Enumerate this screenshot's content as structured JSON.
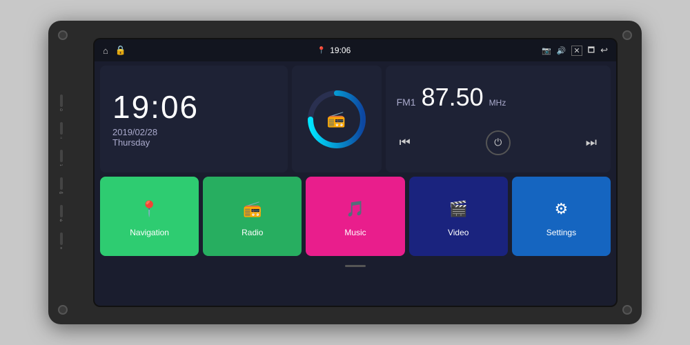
{
  "device": {
    "background_color": "#2a2a2a"
  },
  "status_bar": {
    "left_icons": [
      "home-icon",
      "lock-icon"
    ],
    "location_icon": "📍",
    "time": "19:06",
    "camera_icon": "📷",
    "volume_icon": "🔊",
    "screen_icon": "⬜",
    "window_icon": "🗔",
    "back_icon": "↩"
  },
  "clock": {
    "time": "19:06",
    "date": "2019/02/28",
    "day": "Thursday"
  },
  "radio": {
    "band": "FM1",
    "frequency": "87.50",
    "unit": "MHz",
    "arc_color_start": "#00bcd4",
    "arc_color_end": "#1a237e"
  },
  "apps": [
    {
      "id": "navigation",
      "label": "Navigation",
      "icon": "📍",
      "color": "#2ecc71"
    },
    {
      "id": "radio",
      "label": "Radio",
      "icon": "📻",
      "color": "#27ae60"
    },
    {
      "id": "music",
      "label": "Music",
      "icon": "🎵",
      "color": "#e91e8c"
    },
    {
      "id": "video",
      "label": "Video",
      "icon": "🎬",
      "color": "#283593"
    },
    {
      "id": "settings",
      "label": "Settings",
      "icon": "⚙",
      "color": "#1565c0"
    }
  ],
  "side_buttons": [
    {
      "label": "⏻"
    },
    {
      "label": "⌂"
    },
    {
      "label": "↩"
    },
    {
      "label": "+"
    },
    {
      "label": "🔊"
    },
    {
      "label": "−"
    },
    {
      "label": "⬛"
    }
  ]
}
